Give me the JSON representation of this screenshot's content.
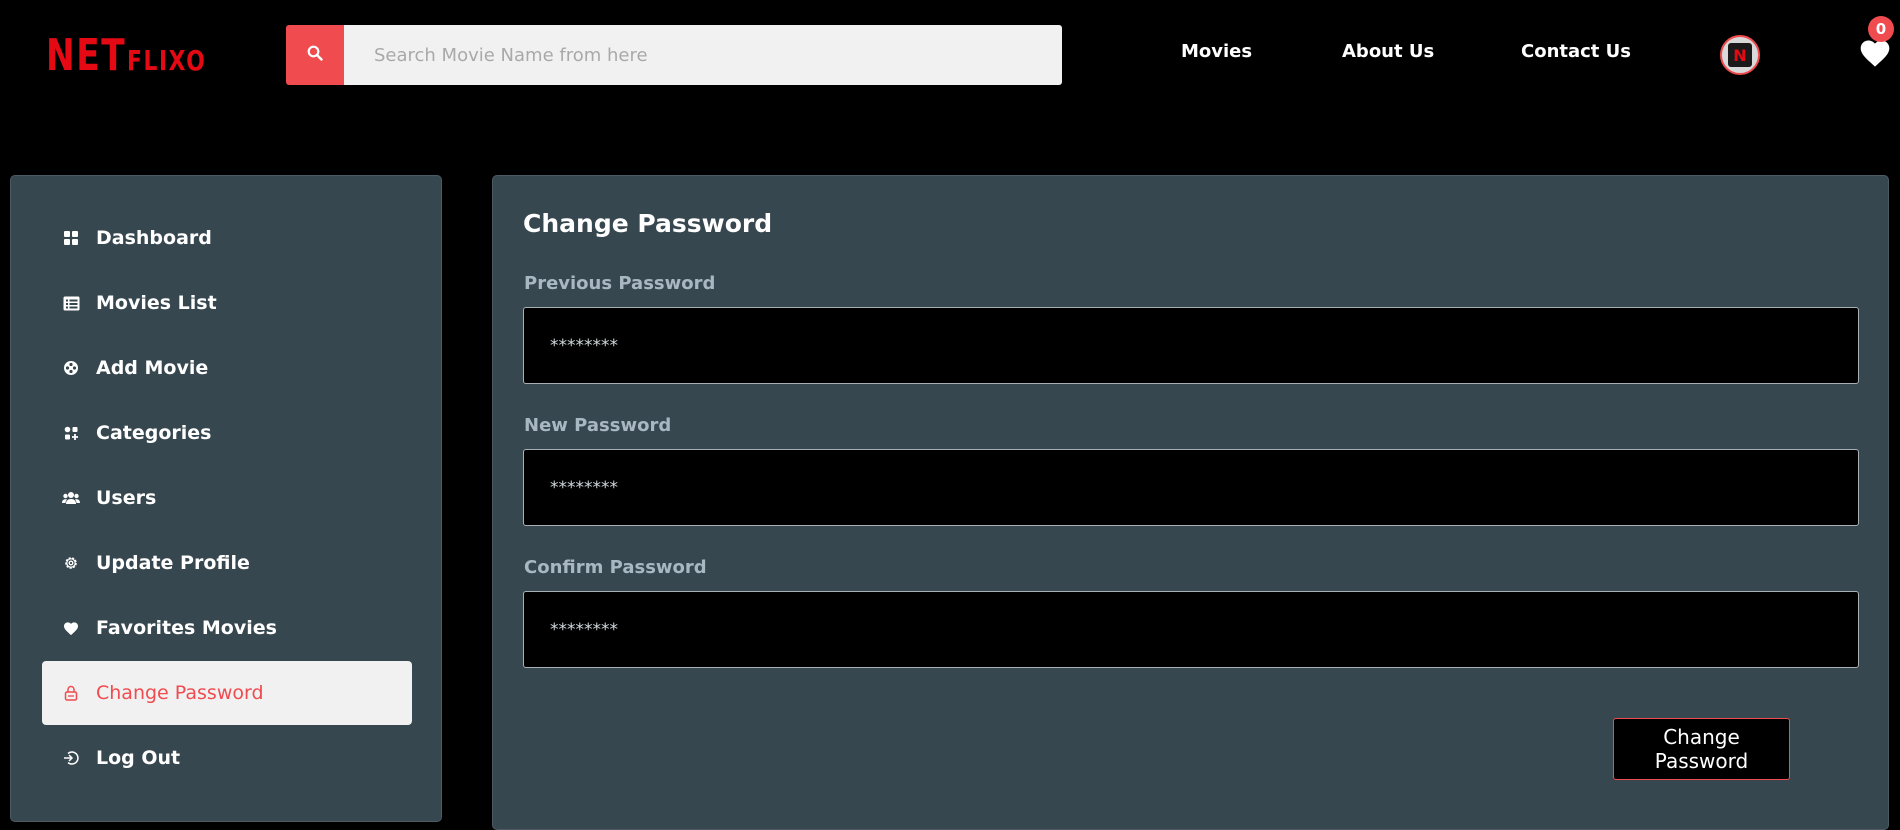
{
  "header": {
    "logo_big": "NET",
    "logo_small": "FLIXO",
    "search_placeholder": "Search Movie Name from here",
    "nav": {
      "movies": "Movies",
      "about": "About Us",
      "contact": "Contact Us"
    },
    "avatar_letter": "N",
    "favorites_count": "0"
  },
  "sidebar": {
    "items": [
      {
        "label": "Dashboard",
        "icon": "dashboard-icon"
      },
      {
        "label": "Movies List",
        "icon": "list-icon"
      },
      {
        "label": "Add Movie",
        "icon": "film-reel-icon"
      },
      {
        "label": "Categories",
        "icon": "categories-icon"
      },
      {
        "label": "Users",
        "icon": "users-icon"
      },
      {
        "label": "Update Profile",
        "icon": "gear-icon"
      },
      {
        "label": "Favorites Movies",
        "icon": "heart-icon"
      },
      {
        "label": "Change Password",
        "icon": "lock-icon",
        "active": true
      },
      {
        "label": "Log Out",
        "icon": "logout-icon"
      }
    ]
  },
  "main": {
    "title": "Change Password",
    "fields": [
      {
        "label": "Previous Password",
        "value": "********"
      },
      {
        "label": "New Password",
        "value": "********"
      },
      {
        "label": "Confirm Password",
        "value": "********"
      }
    ],
    "submit_label": "Change Password"
  },
  "colors": {
    "accent": "#f04b4f",
    "brand": "#e50914",
    "panel": "#37474f",
    "background": "#000000"
  }
}
